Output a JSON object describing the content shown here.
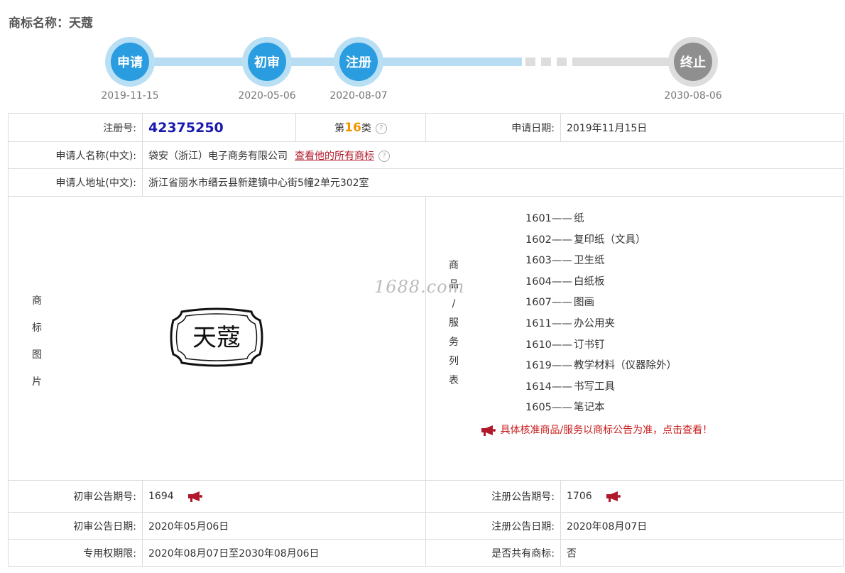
{
  "page_title": "商标名称：天蔻",
  "timeline": [
    {
      "label": "申请",
      "date": "2019-11-15"
    },
    {
      "label": "初审",
      "date": "2020-05-06"
    },
    {
      "label": "注册",
      "date": "2020-08-07"
    },
    {
      "label": "终止",
      "date": "2030-08-06"
    }
  ],
  "row1": {
    "reg_no_label": "注册号:",
    "reg_no": "42375250",
    "class_prefix": "第",
    "class_num": "16",
    "class_suffix": "类",
    "apply_date_label": "申请日期:",
    "apply_date": "2019年11月15日"
  },
  "applicant": {
    "name_label": "申请人名称(中文):",
    "name": "袋安（浙江）电子商务有限公司",
    "all_marks_link": "查看他的所有商标",
    "address_label": "申请人地址(中文):",
    "address": "浙江省丽水市缙云县新建镇中心街5幢2单元302室"
  },
  "mark_image_label": [
    "商",
    "标",
    "图",
    "片"
  ],
  "mark_text": "天蔻",
  "goods_label": [
    "商",
    "品",
    "/",
    "服",
    "务",
    "列",
    "表"
  ],
  "goods": [
    {
      "code": "1601——",
      "name": "纸"
    },
    {
      "code": "1602——",
      "name": "复印纸（文具）"
    },
    {
      "code": "1603——",
      "name": "卫生纸"
    },
    {
      "code": "1604——",
      "name": "白纸板"
    },
    {
      "code": "1607——",
      "name": "图画"
    },
    {
      "code": "1611——",
      "name": "办公用夹"
    },
    {
      "code": "1610——",
      "name": "订书钉"
    },
    {
      "code": "1619——",
      "name": "教学材料（仪器除外）"
    },
    {
      "code": "1614——",
      "name": "书写工具"
    },
    {
      "code": "1605——",
      "name": "笔记本"
    }
  ],
  "goods_notice": "具体核准商品/服务以商标公告为准，点击查看！",
  "watermark": "1688.com",
  "bottom": {
    "prelim_no_label": "初审公告期号:",
    "prelim_no": "1694",
    "reg_ann_no_label": "注册公告期号:",
    "reg_ann_no": "1706",
    "prelim_date_label": "初审公告日期:",
    "prelim_date": "2020年05月06日",
    "reg_ann_date_label": "注册公告日期:",
    "reg_ann_date": "2020年08月07日",
    "period_label": "专用权期限:",
    "period": "2020年08月07日至2030年08月06日",
    "shared_label": "是否共有商标:",
    "shared": "否"
  },
  "colors": {
    "accent": "#2a9de0",
    "track": "#b8dcf2",
    "link": "#b0192b",
    "class_num": "#f29400",
    "reg_no": "#1a1ab0"
  }
}
